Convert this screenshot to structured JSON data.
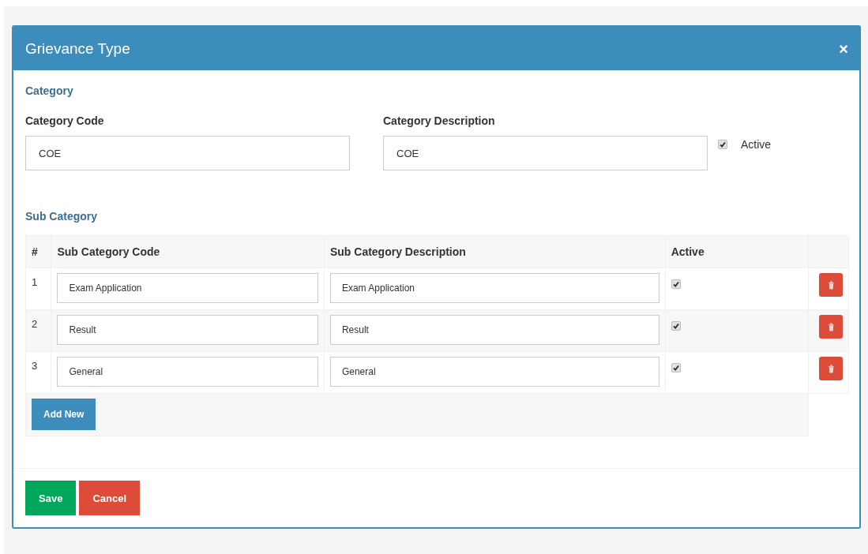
{
  "modal": {
    "title": "Grievance Type",
    "close": "×"
  },
  "category": {
    "heading": "Category",
    "code_label": "Category Code",
    "code_value": "COE",
    "description_label": "Category Description",
    "description_value": "COE",
    "active_label": "Active",
    "active": true
  },
  "sub_category": {
    "heading": "Sub Category",
    "columns": [
      "#",
      "Sub Category Code",
      "Sub Category Description",
      "Active"
    ],
    "rows": [
      {
        "index": "1",
        "code": "Exam Application",
        "description": "Exam Application",
        "active": true
      },
      {
        "index": "2",
        "code": "Result",
        "description": "Result",
        "active": true
      },
      {
        "index": "3",
        "code": "General",
        "description": "General",
        "active": true
      }
    ],
    "add_button": "Add New"
  },
  "buttons": [
    {
      "label": "Save",
      "kind": "primary"
    },
    {
      "label": "Cancel",
      "kind": "danger"
    }
  ]
}
